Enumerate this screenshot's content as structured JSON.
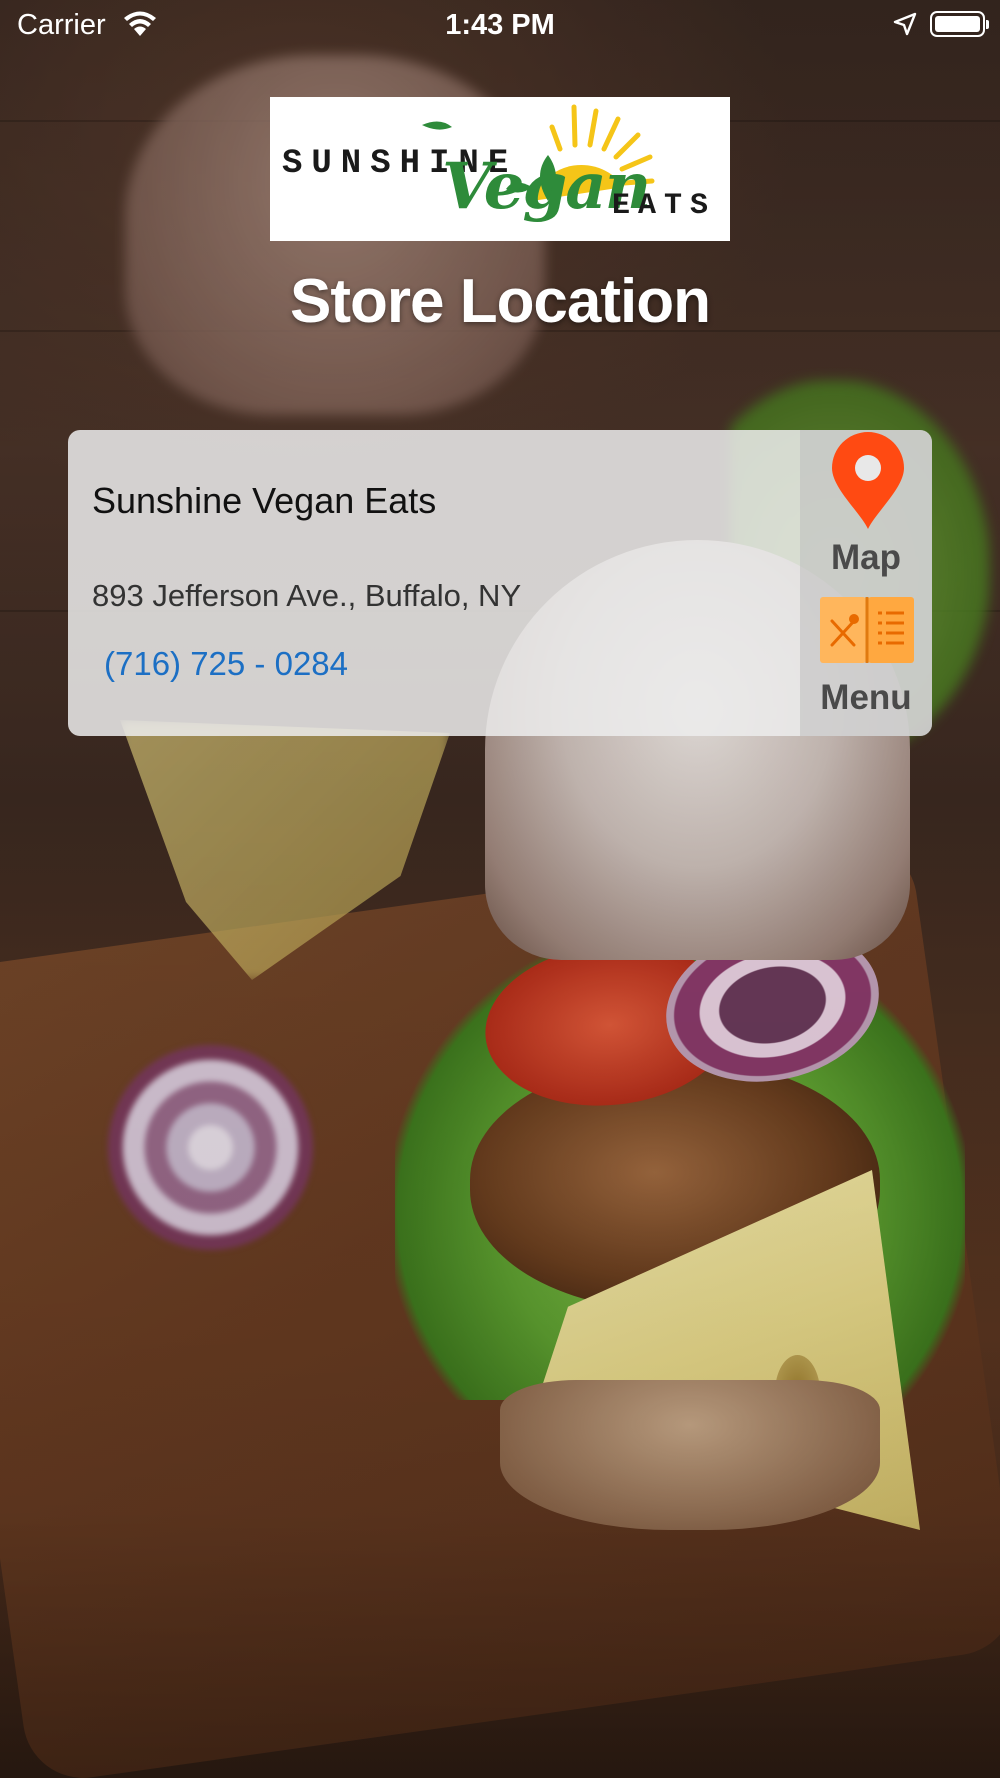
{
  "status_bar": {
    "carrier": "Carrier",
    "time": "1:43 PM",
    "icons": [
      "wifi-icon",
      "location-arrow-icon",
      "battery-icon"
    ]
  },
  "logo": {
    "word_sunshine": "SUNSHINE",
    "word_vegan": "Vegan",
    "word_eats": "EATS",
    "colors": {
      "green": "#2e8b3a",
      "sun": "#f5c518",
      "text": "#1a1a1a"
    }
  },
  "page": {
    "title": "Store Location"
  },
  "store": {
    "name": "Sunshine Vegan Eats",
    "address": "893 Jefferson Ave., Buffalo, NY",
    "phone": "(716) 725 - 0284"
  },
  "actions": {
    "map_label": "Map",
    "menu_label": "Menu",
    "map_icon": "map-pin-icon",
    "menu_icon": "menu-book-icon"
  },
  "colors": {
    "phone_link": "#1c6fc4",
    "map_pin": "#ff4a12",
    "menu_book": "#ffb65c",
    "title_text": "#ffffff"
  }
}
